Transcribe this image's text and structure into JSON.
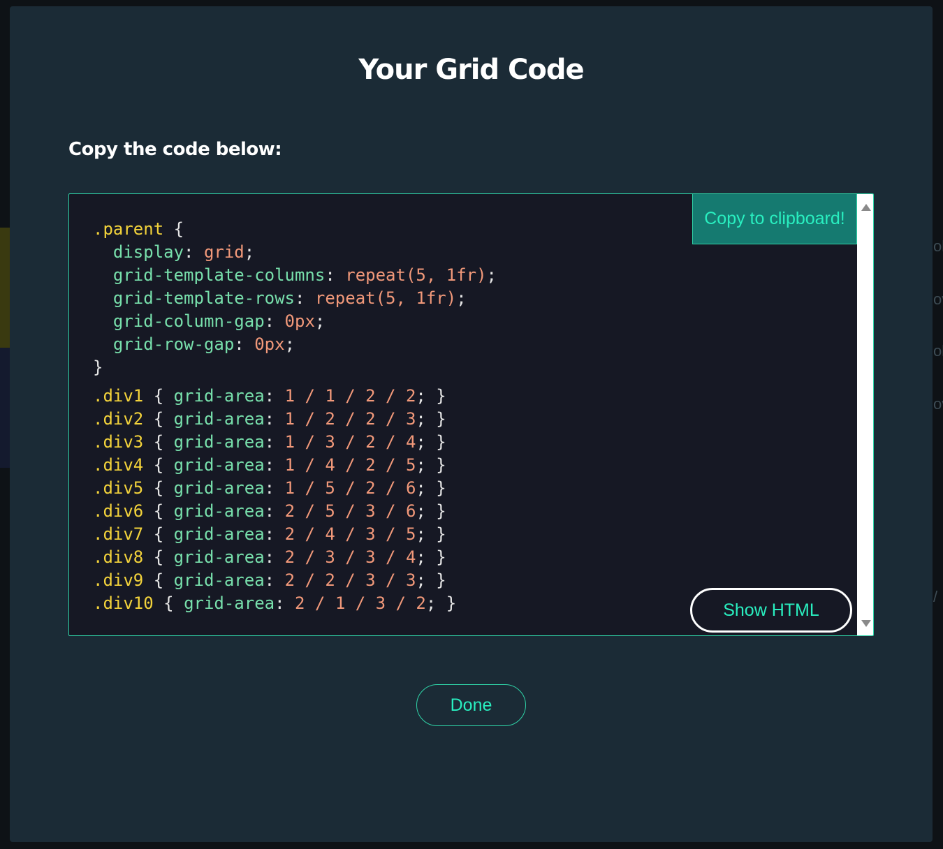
{
  "modal": {
    "title": "Your Grid Code",
    "instructions": "Copy the code below:"
  },
  "buttons": {
    "copy_label": "Copy to clipboard!",
    "show_html_label": "Show HTML",
    "done_label": "Done"
  },
  "background": {
    "right_edge_fragments": [
      "ol",
      "ov",
      "ol",
      "ov",
      "/"
    ]
  },
  "code": {
    "parent_block": [
      [
        {
          "t": ".parent",
          "c": "sel"
        },
        {
          "t": " {",
          "c": "punct"
        }
      ],
      [
        {
          "t": "  display",
          "c": "prop"
        },
        {
          "t": ": ",
          "c": "punct"
        },
        {
          "t": "grid",
          "c": "val"
        },
        {
          "t": ";",
          "c": "punct"
        }
      ],
      [
        {
          "t": "  grid-template-columns",
          "c": "prop"
        },
        {
          "t": ": ",
          "c": "punct"
        },
        {
          "t": "repeat(5, 1fr)",
          "c": "val"
        },
        {
          "t": ";",
          "c": "punct"
        }
      ],
      [
        {
          "t": "  grid-template-rows",
          "c": "prop"
        },
        {
          "t": ": ",
          "c": "punct"
        },
        {
          "t": "repeat(5, 1fr)",
          "c": "val"
        },
        {
          "t": ";",
          "c": "punct"
        }
      ],
      [
        {
          "t": "  grid-column-gap",
          "c": "prop"
        },
        {
          "t": ": ",
          "c": "punct"
        },
        {
          "t": "0px",
          "c": "val"
        },
        {
          "t": ";",
          "c": "punct"
        }
      ],
      [
        {
          "t": "  grid-row-gap",
          "c": "prop"
        },
        {
          "t": ": ",
          "c": "punct"
        },
        {
          "t": "0px",
          "c": "val"
        },
        {
          "t": ";",
          "c": "punct"
        }
      ],
      [
        {
          "t": "}",
          "c": "punct"
        }
      ]
    ],
    "div_block": [
      [
        {
          "t": ".div1",
          "c": "sel"
        },
        {
          "t": " { ",
          "c": "punct"
        },
        {
          "t": "grid-area",
          "c": "prop"
        },
        {
          "t": ": ",
          "c": "punct"
        },
        {
          "t": "1 / 1 / 2 / 2",
          "c": "val"
        },
        {
          "t": "; }",
          "c": "punct"
        }
      ],
      [
        {
          "t": ".div2",
          "c": "sel"
        },
        {
          "t": " { ",
          "c": "punct"
        },
        {
          "t": "grid-area",
          "c": "prop"
        },
        {
          "t": ": ",
          "c": "punct"
        },
        {
          "t": "1 / 2 / 2 / 3",
          "c": "val"
        },
        {
          "t": "; }",
          "c": "punct"
        }
      ],
      [
        {
          "t": ".div3",
          "c": "sel"
        },
        {
          "t": " { ",
          "c": "punct"
        },
        {
          "t": "grid-area",
          "c": "prop"
        },
        {
          "t": ": ",
          "c": "punct"
        },
        {
          "t": "1 / 3 / 2 / 4",
          "c": "val"
        },
        {
          "t": "; }",
          "c": "punct"
        }
      ],
      [
        {
          "t": ".div4",
          "c": "sel"
        },
        {
          "t": " { ",
          "c": "punct"
        },
        {
          "t": "grid-area",
          "c": "prop"
        },
        {
          "t": ": ",
          "c": "punct"
        },
        {
          "t": "1 / 4 / 2 / 5",
          "c": "val"
        },
        {
          "t": "; }",
          "c": "punct"
        }
      ],
      [
        {
          "t": ".div5",
          "c": "sel"
        },
        {
          "t": " { ",
          "c": "punct"
        },
        {
          "t": "grid-area",
          "c": "prop"
        },
        {
          "t": ": ",
          "c": "punct"
        },
        {
          "t": "1 / 5 / 2 / 6",
          "c": "val"
        },
        {
          "t": "; }",
          "c": "punct"
        }
      ],
      [
        {
          "t": ".div6",
          "c": "sel"
        },
        {
          "t": " { ",
          "c": "punct"
        },
        {
          "t": "grid-area",
          "c": "prop"
        },
        {
          "t": ": ",
          "c": "punct"
        },
        {
          "t": "2 / 5 / 3 / 6",
          "c": "val"
        },
        {
          "t": "; }",
          "c": "punct"
        }
      ],
      [
        {
          "t": ".div7",
          "c": "sel"
        },
        {
          "t": " { ",
          "c": "punct"
        },
        {
          "t": "grid-area",
          "c": "prop"
        },
        {
          "t": ": ",
          "c": "punct"
        },
        {
          "t": "2 / 4 / 3 / 5",
          "c": "val"
        },
        {
          "t": "; }",
          "c": "punct"
        }
      ],
      [
        {
          "t": ".div8",
          "c": "sel"
        },
        {
          "t": " { ",
          "c": "punct"
        },
        {
          "t": "grid-area",
          "c": "prop"
        },
        {
          "t": ": ",
          "c": "punct"
        },
        {
          "t": "2 / 3 / 3 / 4",
          "c": "val"
        },
        {
          "t": "; }",
          "c": "punct"
        }
      ],
      [
        {
          "t": ".div9",
          "c": "sel"
        },
        {
          "t": " { ",
          "c": "punct"
        },
        {
          "t": "grid-area",
          "c": "prop"
        },
        {
          "t": ": ",
          "c": "punct"
        },
        {
          "t": "2 / 2 / 3 / 3",
          "c": "val"
        },
        {
          "t": "; }",
          "c": "punct"
        }
      ],
      [
        {
          "t": ".div10",
          "c": "sel"
        },
        {
          "t": " { ",
          "c": "punct"
        },
        {
          "t": "grid-area",
          "c": "prop"
        },
        {
          "t": ": ",
          "c": "punct"
        },
        {
          "t": "2 / 1 / 3 / 2",
          "c": "val"
        },
        {
          "t": "; }",
          "c": "punct"
        }
      ]
    ]
  },
  "colors": {
    "modal_bg": "#1b2b36",
    "code_bg": "#161824",
    "accent": "#2fd3a7",
    "button_text": "#29efc0",
    "copy_button_bg": "#157a70",
    "selector": "#f3d33b",
    "property": "#78e0ac",
    "value": "#f2997a"
  }
}
